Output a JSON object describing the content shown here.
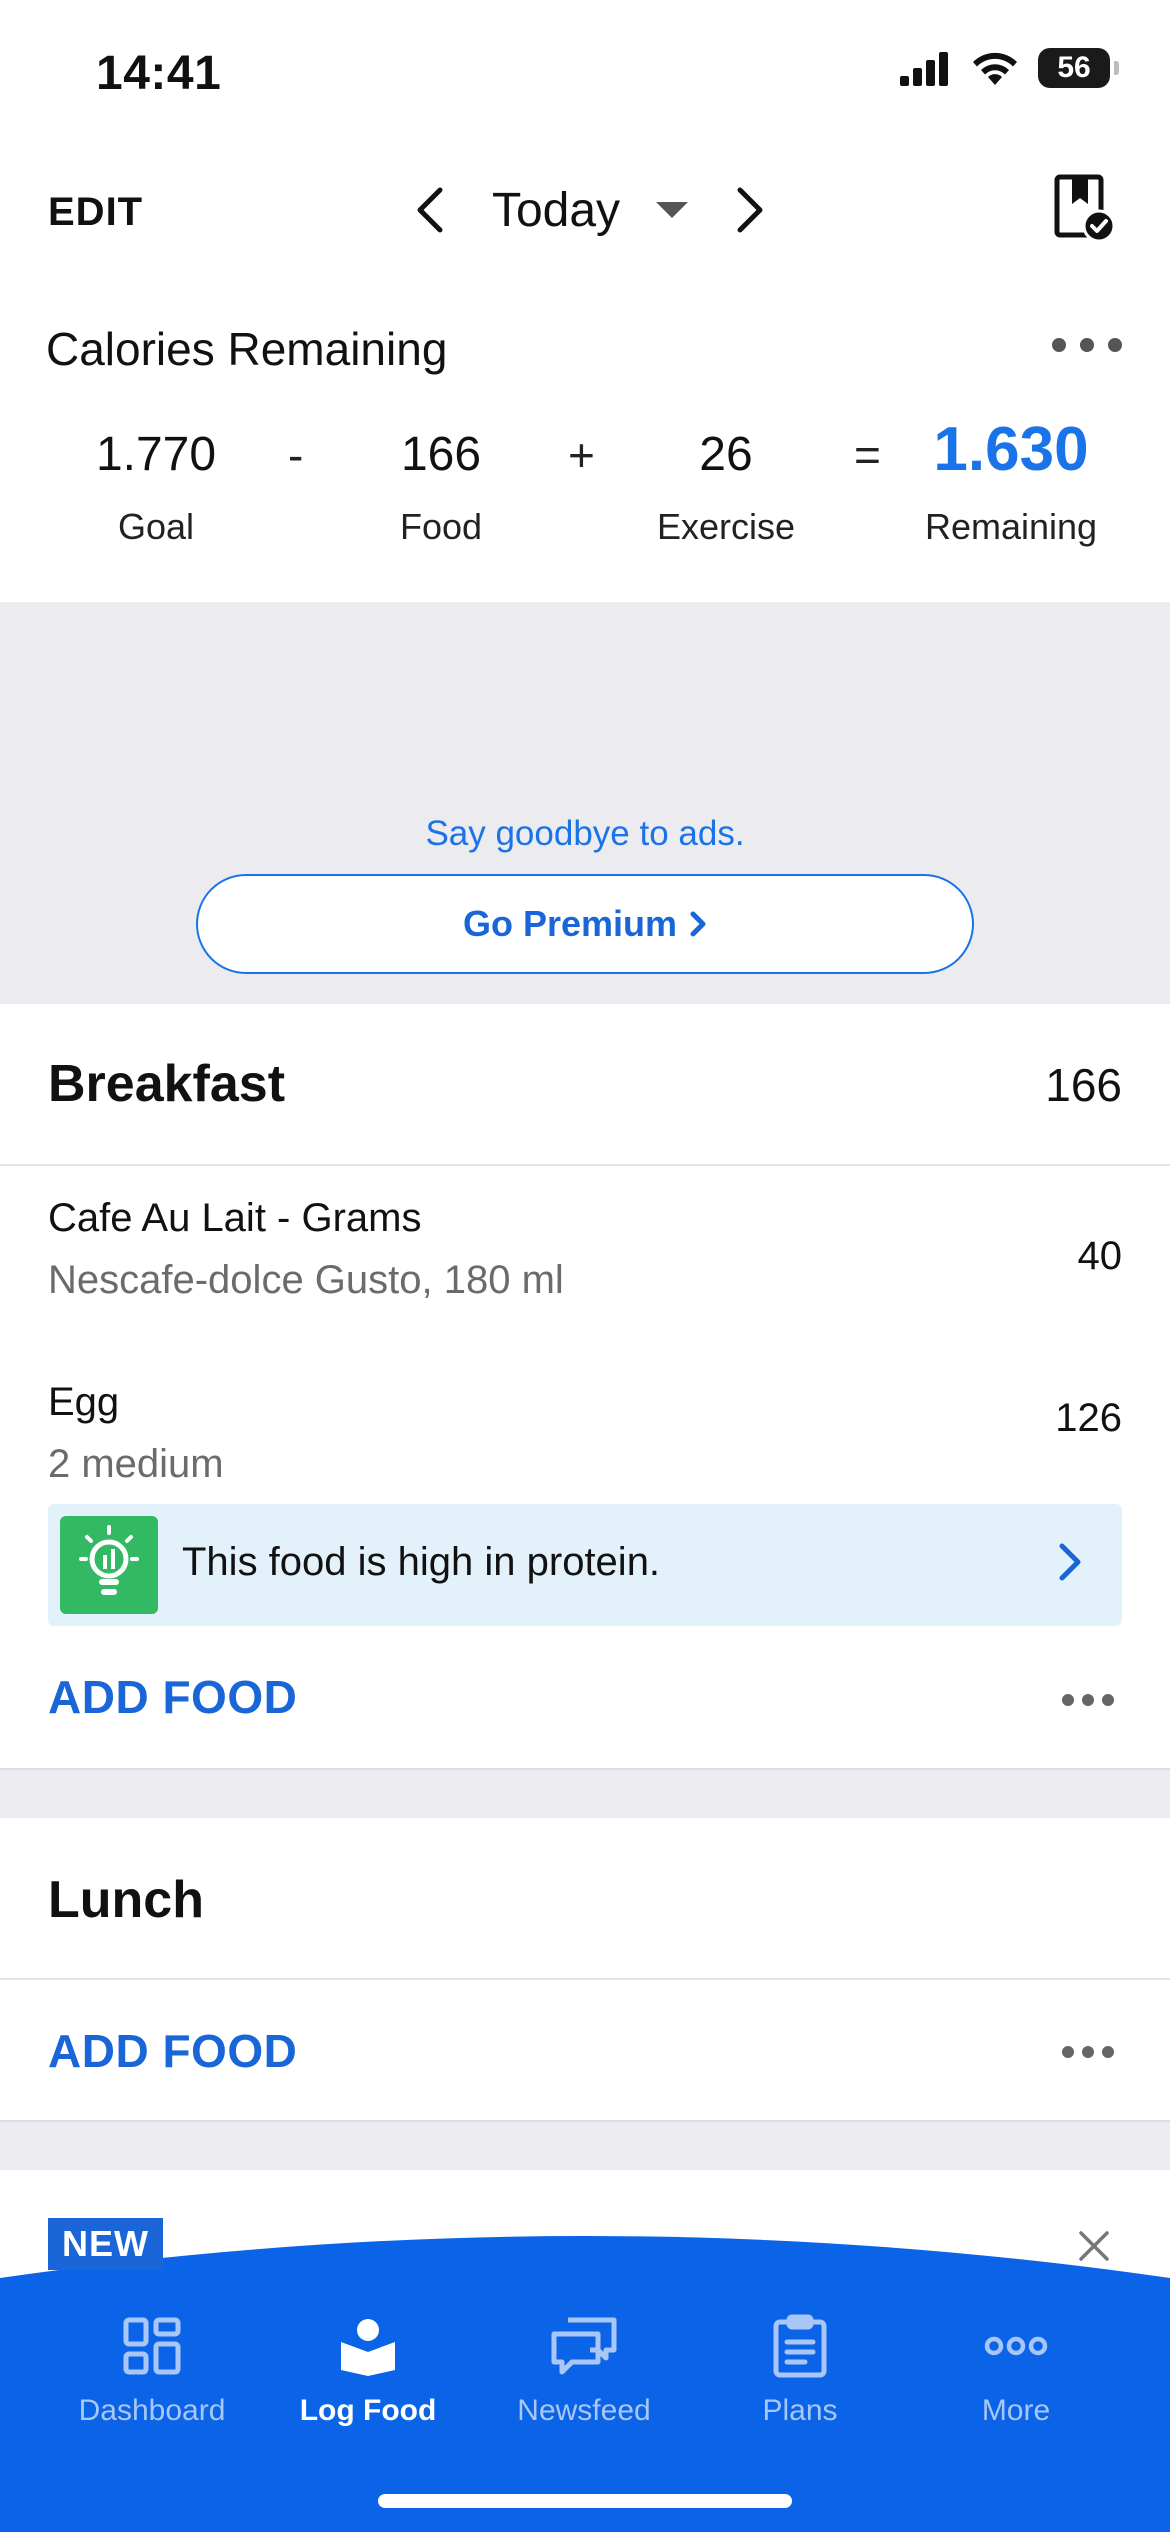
{
  "status_bar": {
    "time": "14:41",
    "battery": "56"
  },
  "header": {
    "edit_label": "EDIT",
    "date_label": "Today"
  },
  "calories": {
    "title": "Calories Remaining",
    "goal_value": "1.770",
    "goal_label": "Goal",
    "minus": "-",
    "food_value": "166",
    "food_label": "Food",
    "plus": "+",
    "exercise_value": "26",
    "exercise_label": "Exercise",
    "equals": "=",
    "remaining_value": "1.630",
    "remaining_label": "Remaining"
  },
  "ad": {
    "text": "Say goodbye to ads.",
    "button_label": "Go Premium"
  },
  "breakfast": {
    "title": "Breakfast",
    "total": "166",
    "items": [
      {
        "name": "Cafe Au Lait - Grams",
        "desc": "Nescafe-dolce Gusto, 180 ml",
        "calories": "40"
      },
      {
        "name": "Egg",
        "desc": "2 medium",
        "calories": "126"
      }
    ],
    "insight": "This food is high in protein.",
    "add_food": "ADD FOOD"
  },
  "lunch": {
    "title": "Lunch",
    "add_food": "ADD FOOD"
  },
  "promo": {
    "badge": "NEW"
  },
  "tabs": [
    {
      "label": "Dashboard",
      "icon": "dashboard-icon",
      "active": false
    },
    {
      "label": "Log Food",
      "icon": "log-food-icon",
      "active": true
    },
    {
      "label": "Newsfeed",
      "icon": "newsfeed-icon",
      "active": false
    },
    {
      "label": "Plans",
      "icon": "plans-icon",
      "active": false
    },
    {
      "label": "More",
      "icon": "more-icon",
      "active": false
    }
  ],
  "colors": {
    "accent": "#1a73e8",
    "tab_bar": "#0b64e8",
    "insight_bg": "#e3f1fb",
    "insight_icon": "#33b864",
    "band": "#ebebf0"
  }
}
